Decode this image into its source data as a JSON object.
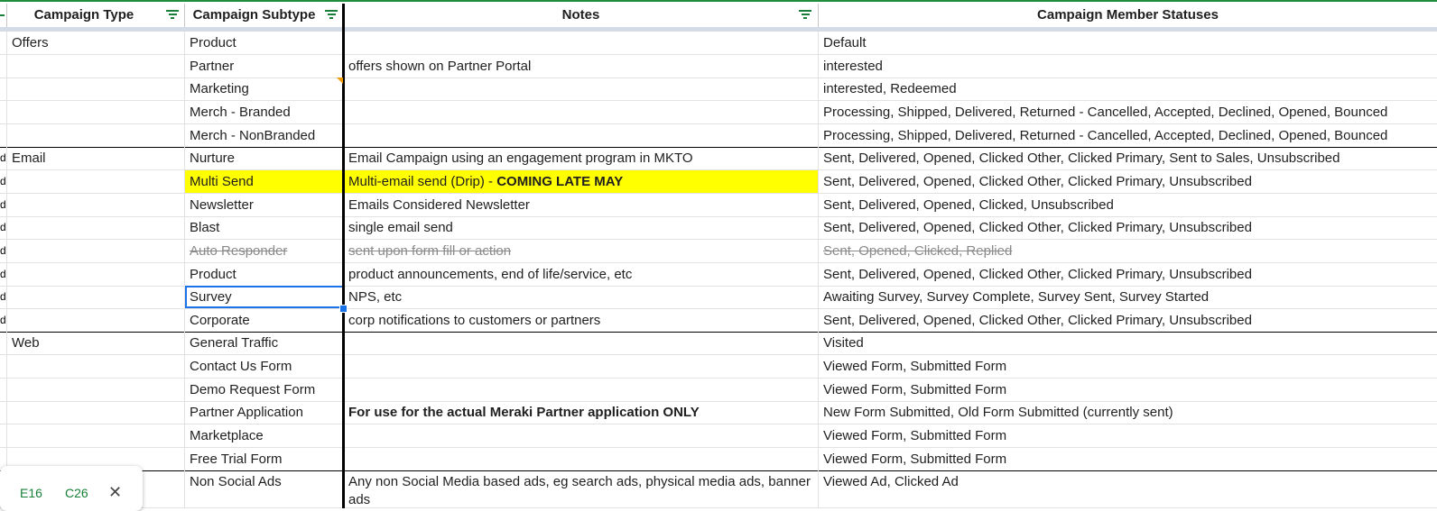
{
  "headers": {
    "campaign_type": "Campaign Type",
    "campaign_subtype": "Campaign Subtype",
    "notes": "Notes",
    "member_statuses": "Campaign Member Statuses"
  },
  "rows": [
    {
      "type": "Offers",
      "subtype": "Product",
      "notes": "",
      "statuses": "Default"
    },
    {
      "type": "",
      "subtype": "Partner",
      "notes": "offers shown on Partner Portal",
      "statuses": "interested"
    },
    {
      "type": "",
      "subtype": "Marketing",
      "notes": "",
      "statuses": "interested, Redeemed"
    },
    {
      "type": "",
      "subtype": "Merch - Branded",
      "notes": "",
      "statuses": "Processing, Shipped, Delivered, Returned - Cancelled, Accepted, Declined, Opened, Bounced"
    },
    {
      "type": "",
      "subtype": "Merch - NonBranded",
      "notes": "",
      "statuses": "Processing, Shipped, Delivered, Returned - Cancelled, Accepted, Declined, Opened, Bounced"
    },
    {
      "type": "Email",
      "subtype": "Nurture",
      "notes": "Email Campaign using an engagement program in MKTO",
      "statuses": "Sent, Delivered, Opened, Clicked Other, Clicked Primary, Sent to Sales, Unsubscribed"
    },
    {
      "type": "",
      "subtype": "Multi Send",
      "notes": "Multi-email send (Drip) - ",
      "notes_bold": "COMING LATE MAY",
      "statuses": "Sent, Delivered, Opened, Clicked Other, Clicked Primary, Unsubscribed"
    },
    {
      "type": "",
      "subtype": "Newsletter",
      "notes": "Emails Considered Newsletter",
      "statuses": "Sent, Delivered, Opened, Clicked, Unsubscribed"
    },
    {
      "type": "",
      "subtype": "Blast",
      "notes": "single email send",
      "statuses": "Sent, Delivered, Opened, Clicked Other, Clicked Primary, Unsubscribed"
    },
    {
      "type": "",
      "subtype": "Auto Responder",
      "notes": "sent upon form fill or action",
      "statuses": "Sent, Opened, Clicked, Replied"
    },
    {
      "type": "",
      "subtype": "Product",
      "notes": "product announcements, end of life/service, etc",
      "statuses": "Sent, Delivered, Opened, Clicked Other, Clicked Primary, Unsubscribed"
    },
    {
      "type": "",
      "subtype": "Survey",
      "notes": "NPS, etc",
      "statuses": "Awaiting Survey, Survey Complete, Survey Sent, Survey Started"
    },
    {
      "type": "",
      "subtype": "Corporate",
      "notes": "corp notifications to customers or partners",
      "statuses": "Sent, Delivered, Opened, Clicked Other, Clicked Primary, Unsubscribed"
    },
    {
      "type": "Web",
      "subtype": "General Traffic",
      "notes": "",
      "statuses": "Visited"
    },
    {
      "type": "",
      "subtype": "Contact Us Form",
      "notes": "",
      "statuses": "Viewed Form, Submitted Form"
    },
    {
      "type": "",
      "subtype": "Demo Request Form",
      "notes": "",
      "statuses": "Viewed Form, Submitted Form"
    },
    {
      "type": "",
      "subtype": "Partner Application",
      "notes": "",
      "notes_bold": "For use for the actual Meraki Partner application ONLY",
      "statuses": "New Form Submitted, Old Form Submitted (currently sent)"
    },
    {
      "type": "",
      "subtype": "Marketplace",
      "notes": "",
      "statuses": "Viewed Form, Submitted Form"
    },
    {
      "type": "",
      "subtype": "Free Trial Form",
      "notes": "",
      "statuses": "Viewed Form, Submitted Form"
    },
    {
      "type": "",
      "subtype": "Non Social Ads",
      "notes": "Any non Social Media based ads, eg search ads, physical media ads, banner ads",
      "statuses": "Viewed Ad, Clicked Ad"
    }
  ],
  "popup": {
    "ref1": "E16",
    "ref2": "C26",
    "close": "✕"
  },
  "colors": {
    "highlight": "#ffff00",
    "selection": "#1a73e8",
    "filter_icon": "#188038",
    "top_border": "#1e8e3e"
  }
}
